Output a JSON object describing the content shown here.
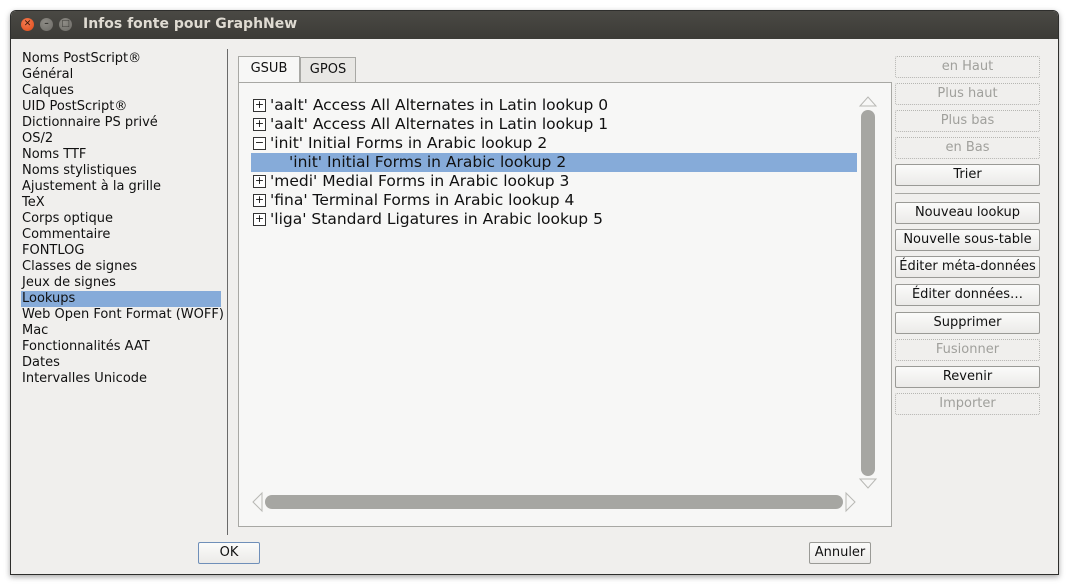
{
  "window": {
    "title": "Infos fonte pour GraphNew"
  },
  "sidebar": {
    "items": [
      "Noms PostScript®",
      "Général",
      "Calques",
      "UID PostScript®",
      "Dictionnaire PS privé",
      "OS/2",
      "Noms TTF",
      "Noms stylistiques",
      "Ajustement à la grille",
      "TeX",
      "Corps optique",
      "Commentaire",
      "FONTLOG",
      "Classes de signes",
      "Jeux de signes",
      "Lookups",
      "Web Open Font Format (WOFF)",
      "Mac",
      "Fonctionnalités AAT",
      "Dates",
      "Intervalles Unicode"
    ],
    "selected": "Lookups"
  },
  "tabs": [
    {
      "label": "GSUB",
      "active": true
    },
    {
      "label": "GPOS",
      "active": false
    }
  ],
  "lookups": [
    {
      "label": "'aalt' Access All Alternates in Latin lookup 0",
      "expanded": false
    },
    {
      "label": "'aalt' Access All Alternates in Latin lookup 1",
      "expanded": false
    },
    {
      "label": "'init' Initial Forms in Arabic lookup 2",
      "expanded": true
    },
    {
      "label": "'init' Initial Forms in Arabic lookup 2",
      "child": true,
      "selected": true
    },
    {
      "label": "'medi' Medial Forms in Arabic lookup 3",
      "expanded": false
    },
    {
      "label": "'fina' Terminal Forms in Arabic lookup 4",
      "expanded": false
    },
    {
      "label": "'liga' Standard Ligatures in Arabic lookup 5",
      "expanded": false
    }
  ],
  "buttons": {
    "en_haut": "en Haut",
    "plus_haut": "Plus haut",
    "plus_bas": "Plus bas",
    "en_bas": "en Bas",
    "trier": "Trier",
    "nouveau_lookup": "Nouveau lookup",
    "nouvelle_sous_table": "Nouvelle sous-table",
    "editer_meta": "Éditer méta-données",
    "editer_donnees": "Éditer données…",
    "supprimer": "Supprimer",
    "fusionner": "Fusionner",
    "revenir": "Revenir",
    "importer": "Importer",
    "ok": "OK",
    "annuler": "Annuler"
  },
  "colors": {
    "selection": "#86abd9",
    "titlebar": "#3c3b37"
  }
}
